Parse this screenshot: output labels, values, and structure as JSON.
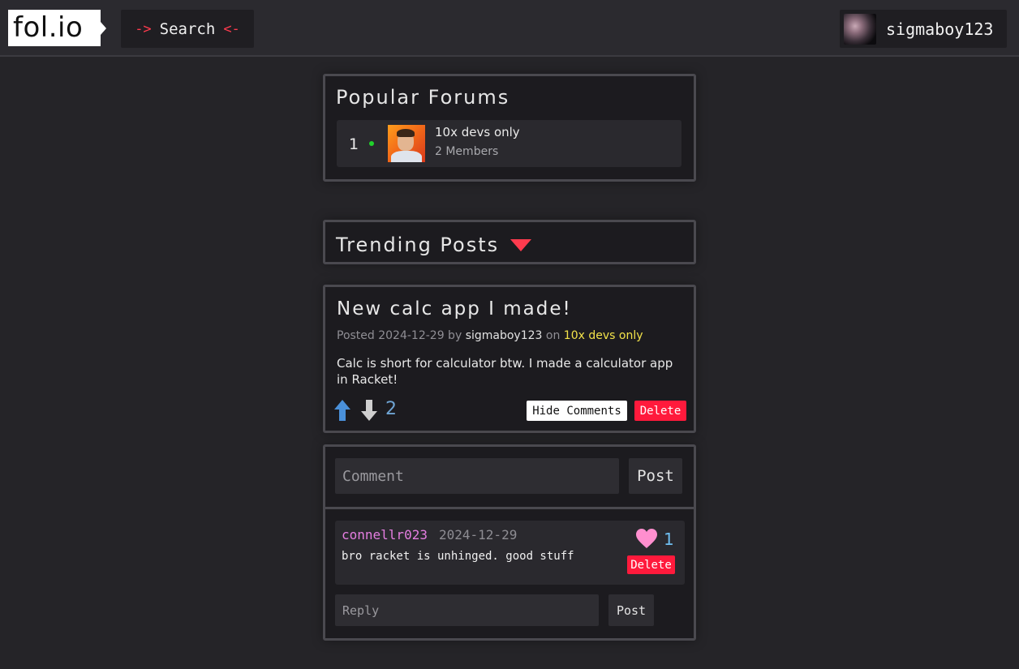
{
  "header": {
    "logo": "fol.io",
    "search_arrow_left": "->",
    "search_label": "Search",
    "search_arrow_right": "<-",
    "username": "sigmaboy123"
  },
  "popular_forums": {
    "title": "Popular Forums",
    "items": [
      {
        "rank": "1",
        "name": "10x devs only",
        "members": "2 Members",
        "online_color": "#20d22b"
      }
    ]
  },
  "trending": {
    "title": "Trending Posts",
    "icon": "triangle-down-icon",
    "accent": "#ff3b4e"
  },
  "post": {
    "title": "New calc app I made!",
    "meta_prefix": "Posted 2024-12-29 by",
    "author": "sigmaboy123",
    "meta_on": "on",
    "forum": "10x devs only",
    "body": "Calc is short for calculator btw. I made a calculator app in Racket!",
    "score": "2",
    "hide_comments_label": "Hide Comments",
    "delete_label": "Delete"
  },
  "comments": {
    "input_placeholder": "Comment",
    "post_label": "Post",
    "items": [
      {
        "author": "connellr023",
        "date": "2024-12-29",
        "text": "bro racket is unhinged. good stuff",
        "likes": "1",
        "delete_label": "Delete"
      }
    ],
    "reply_placeholder": "Reply",
    "reply_post_label": "Post"
  },
  "colors": {
    "background": "#252428",
    "card": "#1c1b1f",
    "danger": "#ff1a3c",
    "forum_link": "#f3e34a",
    "comment_author": "#e57ee1",
    "heart": "#ff8fcf",
    "upvote": "#4a90d9"
  }
}
